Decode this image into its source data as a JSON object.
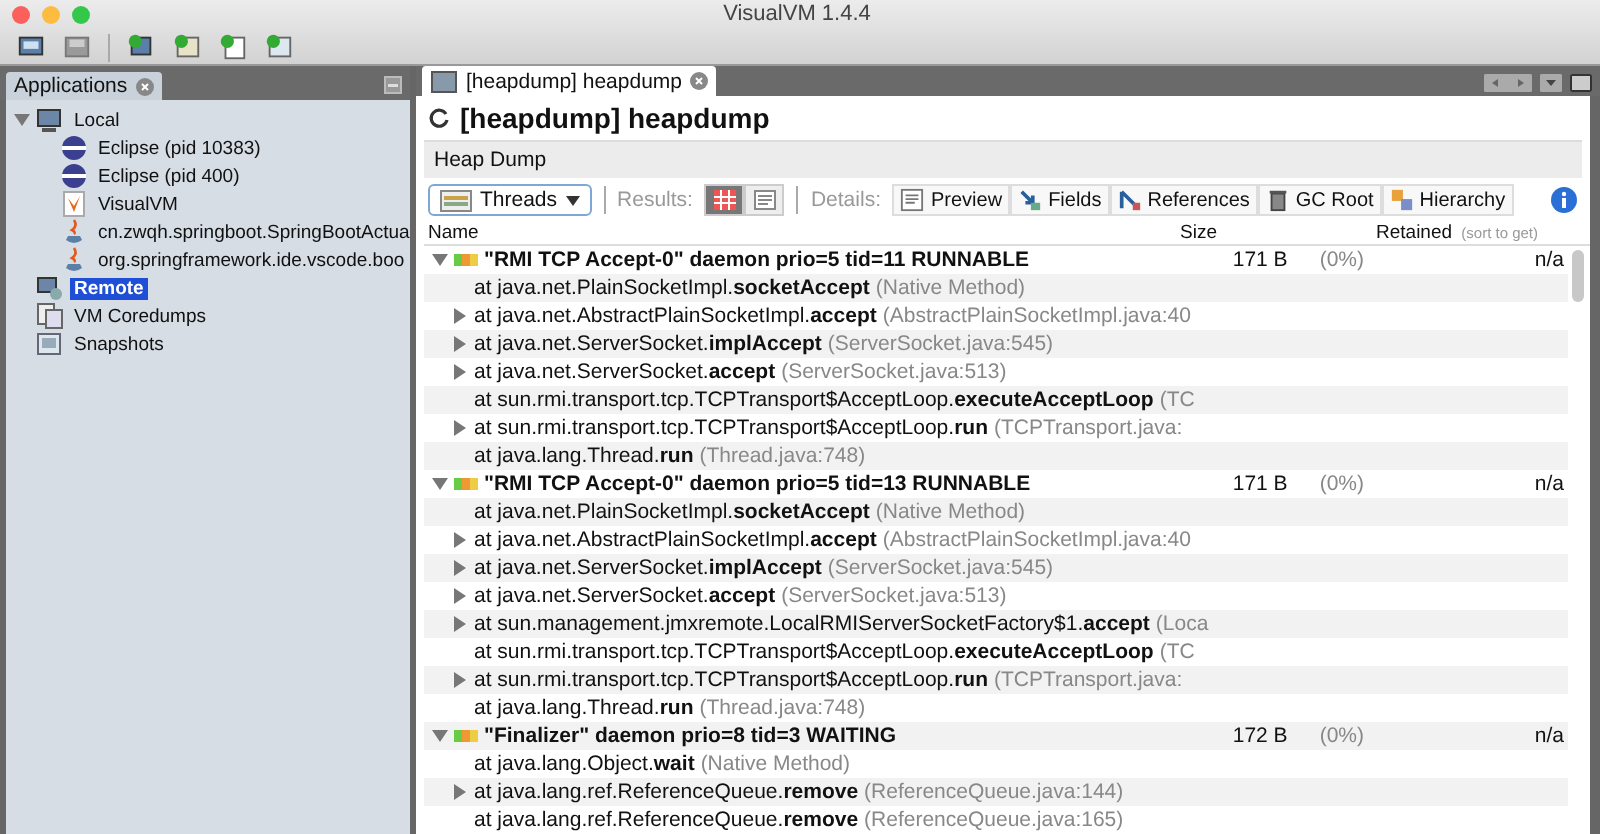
{
  "window": {
    "title": "VisualVM 1.4.4"
  },
  "toolbar": [
    {
      "kind": "open"
    },
    {
      "kind": "save"
    },
    {
      "kind": "add-host"
    },
    {
      "kind": "add-jmx"
    },
    {
      "kind": "add-snapshot"
    },
    {
      "kind": "add-coredump"
    }
  ],
  "sidebar": {
    "tab": "Applications",
    "items": [
      {
        "label": "Local",
        "kind": "computer",
        "selected": false,
        "expanded": true,
        "children": [
          {
            "label": "Eclipse (pid 10383)",
            "kind": "eclipse",
            "selected": false
          },
          {
            "label": "Eclipse (pid 400)",
            "kind": "eclipse",
            "selected": false
          },
          {
            "label": "VisualVM",
            "kind": "visualvm",
            "selected": false
          },
          {
            "label": "cn.zwqh.springboot.SpringBootActua",
            "kind": "java",
            "selected": false
          },
          {
            "label": "org.springframework.ide.vscode.boo",
            "kind": "java",
            "selected": false
          }
        ]
      },
      {
        "label": "Remote",
        "kind": "remote",
        "selected": true
      },
      {
        "label": "VM Coredumps",
        "kind": "coredump",
        "selected": false
      },
      {
        "label": "Snapshots",
        "kind": "snapshot",
        "selected": false
      }
    ]
  },
  "document": {
    "tab": "[heapdump] heapdump",
    "title": "[heapdump] heapdump",
    "section": "Heap Dump",
    "view_dropdown": "Threads",
    "results_label": "Results:",
    "results": [
      {
        "kind": "table",
        "selected": true
      },
      {
        "kind": "text",
        "selected": false
      }
    ],
    "details_label": "Details:",
    "details": [
      {
        "label": "Preview"
      },
      {
        "label": "Fields"
      },
      {
        "label": "References"
      },
      {
        "label": "GC Root"
      },
      {
        "label": "Hierarchy"
      }
    ],
    "table": {
      "columns": [
        {
          "label": "Name"
        },
        {
          "label": "Size"
        },
        {
          "label": "Retained",
          "hint": "(sort to get)"
        }
      ],
      "rows": [
        {
          "name": "\"RMI TCP Accept-0\" daemon prio=5 tid=11 RUNNABLE",
          "size": "171 B",
          "percent": "(0%)",
          "retained": "n/a",
          "expanded": true,
          "children": [
            {
              "text": "at java.net.PlainSocketImpl.**socketAccept**",
              "source": "(Native Method)",
              "expandable": false
            },
            {
              "text": "at java.net.AbstractPlainSocketImpl.**accept**",
              "source": "(AbstractPlainSocketImpl.java:40",
              "expandable": true
            },
            {
              "text": "at java.net.ServerSocket.**implAccept**",
              "source": "(ServerSocket.java:545)",
              "expandable": true
            },
            {
              "text": "at java.net.ServerSocket.**accept**",
              "source": "(ServerSocket.java:513)",
              "expandable": true
            },
            {
              "text": "at sun.rmi.transport.tcp.TCPTransport$AcceptLoop.**executeAcceptLoop**",
              "source": "(TC",
              "expandable": false
            },
            {
              "text": "at sun.rmi.transport.tcp.TCPTransport$AcceptLoop.**run**",
              "source": "(TCPTransport.java:",
              "expandable": true
            },
            {
              "text": "at java.lang.Thread.**run**",
              "source": "(Thread.java:748)",
              "expandable": false
            }
          ]
        },
        {
          "name": "\"RMI TCP Accept-0\" daemon prio=5 tid=13 RUNNABLE",
          "size": "171 B",
          "percent": "(0%)",
          "retained": "n/a",
          "expanded": true,
          "children": [
            {
              "text": "at java.net.PlainSocketImpl.**socketAccept**",
              "source": "(Native Method)",
              "expandable": false
            },
            {
              "text": "at java.net.AbstractPlainSocketImpl.**accept**",
              "source": "(AbstractPlainSocketImpl.java:40",
              "expandable": true
            },
            {
              "text": "at java.net.ServerSocket.**implAccept**",
              "source": "(ServerSocket.java:545)",
              "expandable": true
            },
            {
              "text": "at java.net.ServerSocket.**accept**",
              "source": "(ServerSocket.java:513)",
              "expandable": true
            },
            {
              "text": "at sun.management.jmxremote.LocalRMIServerSocketFactory$1.**accept**",
              "source": "(Loca",
              "expandable": true
            },
            {
              "text": "at sun.rmi.transport.tcp.TCPTransport$AcceptLoop.**executeAcceptLoop**",
              "source": "(TC",
              "expandable": false
            },
            {
              "text": "at sun.rmi.transport.tcp.TCPTransport$AcceptLoop.**run**",
              "source": "(TCPTransport.java:",
              "expandable": true
            },
            {
              "text": "at java.lang.Thread.**run**",
              "source": "(Thread.java:748)",
              "expandable": false
            }
          ]
        },
        {
          "name": "\"Finalizer\" daemon prio=8 tid=3 WAITING",
          "size": "172 B",
          "percent": "(0%)",
          "retained": "n/a",
          "expanded": true,
          "children": [
            {
              "text": "at java.lang.Object.**wait**",
              "source": "(Native Method)",
              "expandable": false
            },
            {
              "text": "at java.lang.ref.ReferenceQueue.**remove**",
              "source": "(ReferenceQueue.java:144)",
              "expandable": true
            },
            {
              "text": "at java.lang.ref.ReferenceQueue.**remove**",
              "source": "(ReferenceQueue.java:165)",
              "expandable": false
            }
          ]
        }
      ]
    }
  }
}
